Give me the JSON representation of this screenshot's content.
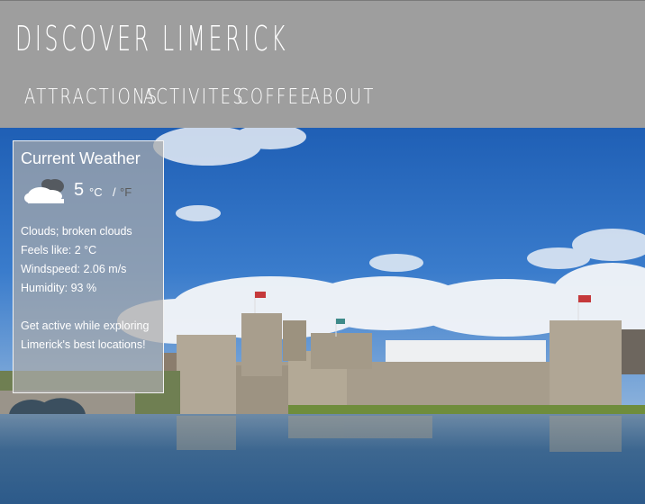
{
  "site": {
    "title": "DISCOVER LIMERICK"
  },
  "nav": {
    "items": [
      {
        "label": "ATTRACTIONS"
      },
      {
        "label": "ACTIVITES"
      },
      {
        "label": "COFFEE"
      },
      {
        "label": "ABOUT"
      }
    ]
  },
  "weather": {
    "title": "Current Weather",
    "icon": "broken-clouds-icon",
    "temp": "5",
    "unit_c": "°C",
    "unit_sep": "/",
    "unit_f": "°F",
    "description": "Clouds; broken clouds",
    "feels_like": "Feels like: 2 °C",
    "windspeed": "Windspeed: 2.06 m/s",
    "humidity": "Humidity: 93 %",
    "promo": "Get active while exploring Limerick's best locations!"
  },
  "colors": {
    "header_bg": "#9e9e9e",
    "sky": "#2f6fbf",
    "water": "#3d6790"
  }
}
